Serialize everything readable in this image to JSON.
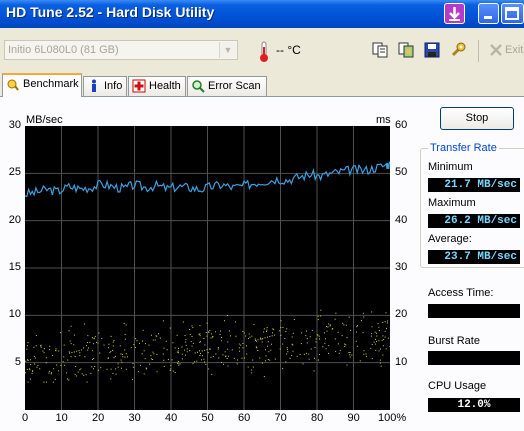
{
  "window": {
    "title": "HD Tune 2.52 - Hard Disk Utility"
  },
  "toolbar": {
    "drive": "Initio  6L080L0 (81 GB)",
    "temperature": "-- °C",
    "exit_label": "Exit",
    "icons": [
      "copy-icon",
      "copy-screenshot-icon",
      "save-icon",
      "options-icon",
      "exit-icon"
    ]
  },
  "tabs": [
    {
      "label": "Benchmark",
      "icon": "benchmark-icon",
      "active": true
    },
    {
      "label": "Info",
      "icon": "info-icon",
      "active": false
    },
    {
      "label": "Health",
      "icon": "health-icon",
      "active": false
    },
    {
      "label": "Error Scan",
      "icon": "error-scan-icon",
      "active": false
    }
  ],
  "benchmark": {
    "stop_label": "Stop",
    "transfer_rate_title": "Transfer Rate",
    "minimum_label": "Minimum",
    "minimum_value": "21.7 MB/sec",
    "maximum_label": "Maximum",
    "maximum_value": "26.2 MB/sec",
    "average_label": "Average:",
    "average_value": "23.7 MB/sec",
    "access_time_label": "Access Time:",
    "access_time_value": "",
    "burst_rate_label": "Burst Rate",
    "burst_rate_value": "",
    "cpu_usage_label": "CPU Usage",
    "cpu_usage_value": "12.0%"
  },
  "chart_data": {
    "type": "line",
    "ylabel_left": "MB/sec",
    "ylabel_right": "ms",
    "xlim": [
      0,
      100
    ],
    "ylim_left": [
      0,
      30
    ],
    "ylim_right": [
      0,
      60
    ],
    "x_ticks": [
      "0",
      "10",
      "20",
      "30",
      "40",
      "50",
      "60",
      "70",
      "80",
      "90",
      "100%"
    ],
    "y_ticks_left": [
      "30",
      "25",
      "20",
      "15",
      "10",
      "5"
    ],
    "y_ticks_right": [
      "60",
      "50",
      "40",
      "30",
      "20",
      "10"
    ],
    "grid": true,
    "colors": {
      "background": "#000000",
      "grid": "#505050",
      "transfer": "#3aa0e0",
      "access": "#d8d840"
    },
    "series": [
      {
        "type": "line",
        "axis": "left",
        "x": [
          0,
          3,
          6,
          9,
          12,
          15,
          18,
          21,
          24,
          27,
          30,
          33,
          36,
          39,
          42,
          45,
          48,
          51,
          54,
          57,
          60,
          63,
          66,
          69,
          72,
          75,
          78,
          81,
          84,
          87,
          90,
          93,
          96,
          99,
          100
        ],
        "values": [
          22.8,
          23.0,
          23.3,
          23.1,
          23.6,
          23.4,
          23.5,
          23.9,
          23.6,
          23.4,
          23.8,
          23.5,
          23.7,
          23.4,
          23.6,
          23.5,
          23.3,
          23.6,
          23.8,
          23.5,
          23.7,
          24.0,
          24.2,
          24.4,
          24.3,
          24.6,
          24.9,
          24.7,
          25.0,
          25.2,
          25.4,
          25.3,
          25.6,
          25.9,
          26.0
        ]
      },
      {
        "type": "scatter",
        "axis": "right",
        "x_range": [
          0,
          100
        ],
        "y_range_ms": [
          6,
          24
        ],
        "trend_start_ms": 11,
        "trend_end_ms": 16
      }
    ]
  }
}
